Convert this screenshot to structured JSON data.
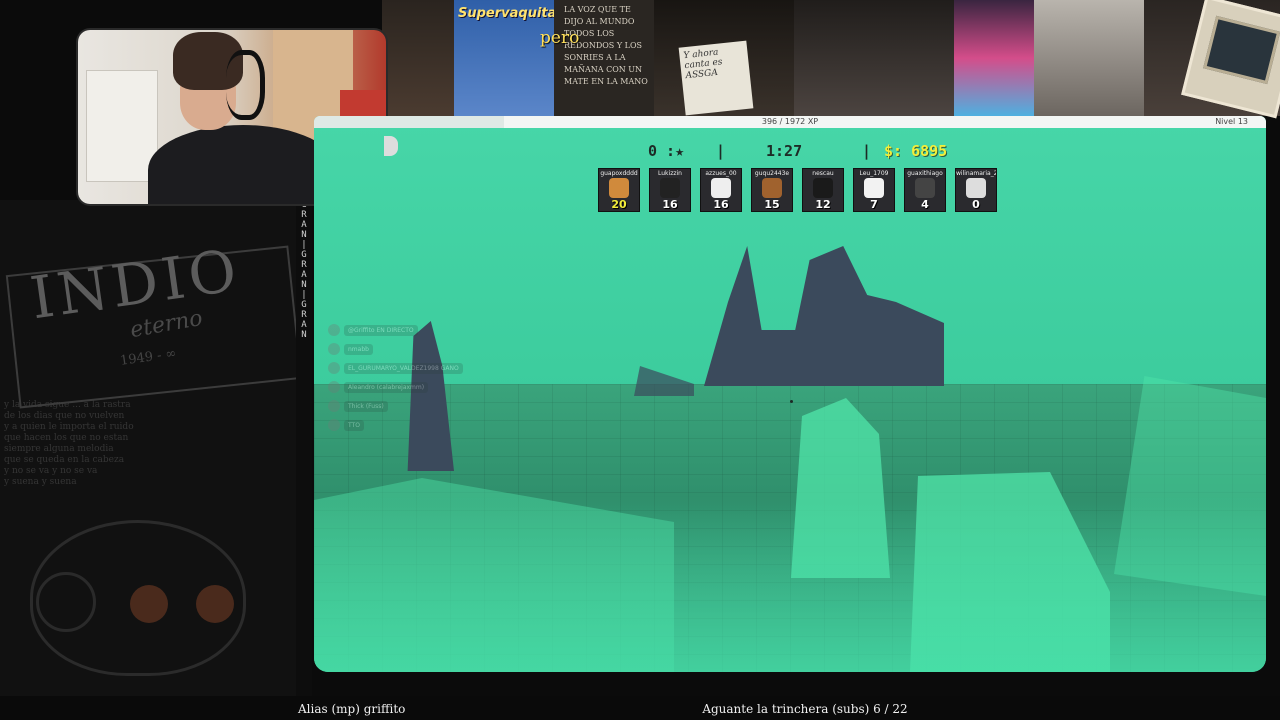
{
  "overlay": {
    "caption": "pero",
    "banner_text_supervaquita": "Supervaquita",
    "banner_text_poster": "LA VOZ QUE TE DIJO AL MUNDO TODOS LOS REDONDOS Y LOS SONRIES A LA MAÑANA CON UN MATE EN LA MANO",
    "banner_note": "Y ahora canta es ASSGA",
    "art_title": "INDIO",
    "art_subtitle": "eterno",
    "art_years": "1949 - ∞",
    "bottom_left": "Alias (mp) griffito",
    "bottom_center": "Aguante la trinchera (subs) 6 / 22",
    "vertical_strip": "GRAN|GRAN|GRAN"
  },
  "game": {
    "xp_text": "396 / 1972 XP",
    "xp_progress": 0.2,
    "level_text": "Nivel 13",
    "stars": "0 :★",
    "separator": "|",
    "timer": "1:27",
    "money_label": "$:",
    "money_value": "6895",
    "players": [
      {
        "name": "guapoxdddd",
        "score": "20"
      },
      {
        "name": "Lukizzin",
        "score": "16"
      },
      {
        "name": "azzues_00",
        "score": "16"
      },
      {
        "name": "guqu2443e",
        "score": "15"
      },
      {
        "name": "nescau",
        "score": "12"
      },
      {
        "name": "Leu_1709",
        "score": "7"
      },
      {
        "name": "guaxithiago",
        "score": "4"
      },
      {
        "name": "wilinamaria_2",
        "score": "0"
      }
    ],
    "chat": [
      {
        "text": "@Griffito  EN DIRECTO"
      },
      {
        "text": "nmabb"
      },
      {
        "text": "EL_GURUMARYO_VALDEZ1998   GANO"
      },
      {
        "text": "Aleandro (calabrejaxmm)"
      },
      {
        "text": "Thick (Fuss)"
      },
      {
        "text": "TTO"
      }
    ]
  },
  "colors": {
    "money": "#f3ee3a",
    "game_bg": "#3fcf9f",
    "rock": "#3b4a5c",
    "caption": "#ffe05a"
  }
}
